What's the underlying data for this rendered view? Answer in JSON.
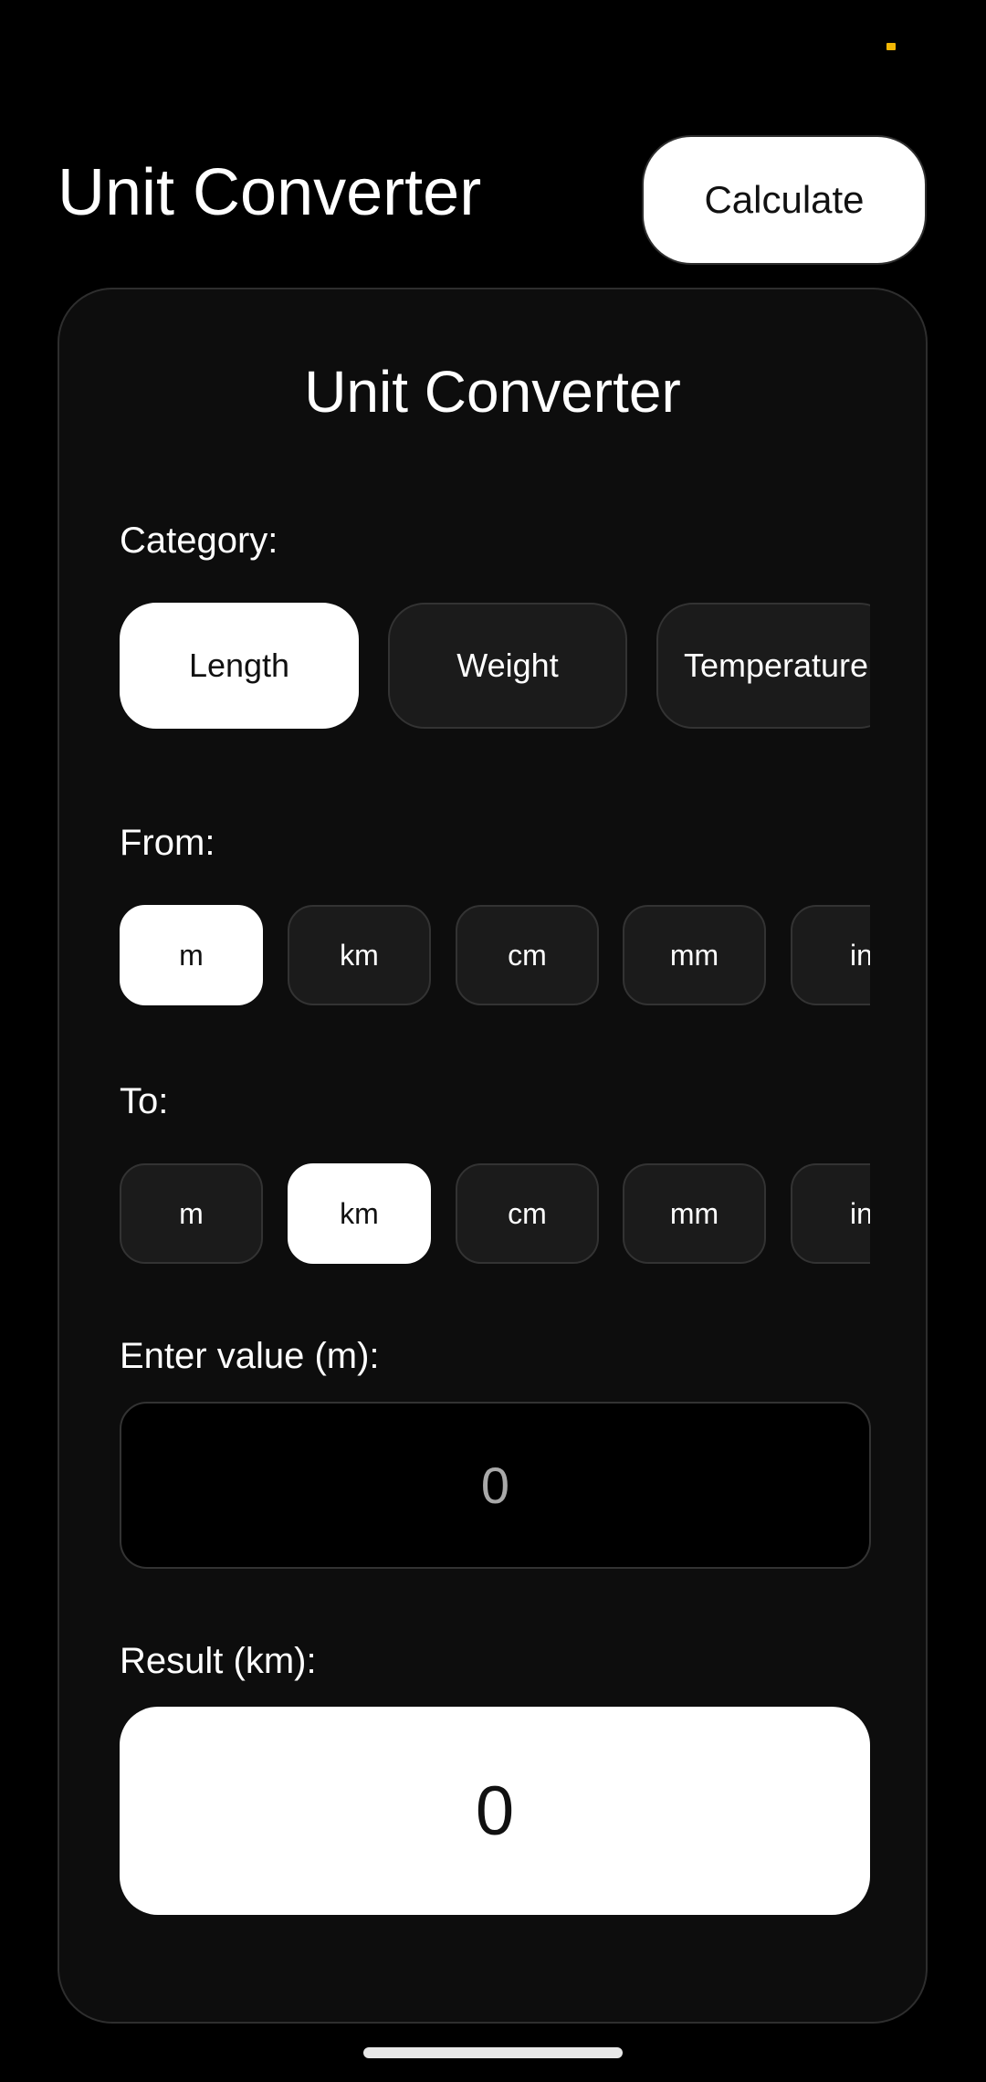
{
  "app": {
    "title": "Unit Converter",
    "calculate_label": "Calculate"
  },
  "card": {
    "title": "Unit Converter",
    "category_label": "Category:",
    "categories": [
      {
        "label": "Length",
        "selected": true
      },
      {
        "label": "Weight",
        "selected": false
      },
      {
        "label": "Temperature",
        "selected": false
      }
    ],
    "from_label": "From:",
    "from_units": [
      {
        "label": "m",
        "selected": true
      },
      {
        "label": "km",
        "selected": false
      },
      {
        "label": "cm",
        "selected": false
      },
      {
        "label": "mm",
        "selected": false
      },
      {
        "label": "in",
        "selected": false
      }
    ],
    "to_label": "To:",
    "to_units": [
      {
        "label": "m",
        "selected": false
      },
      {
        "label": "km",
        "selected": true
      },
      {
        "label": "cm",
        "selected": false
      },
      {
        "label": "mm",
        "selected": false
      },
      {
        "label": "in",
        "selected": false
      }
    ],
    "input_label": "Enter value (m):",
    "input_placeholder": "0",
    "result_label": "Result (km):",
    "result_value": "0"
  },
  "colors": {
    "background": "#000000",
    "card": "#0d0d0d",
    "chip": "#1b1b1b",
    "selected": "#ffffff",
    "border": "#333333",
    "status_indicator": "#f2b705"
  }
}
